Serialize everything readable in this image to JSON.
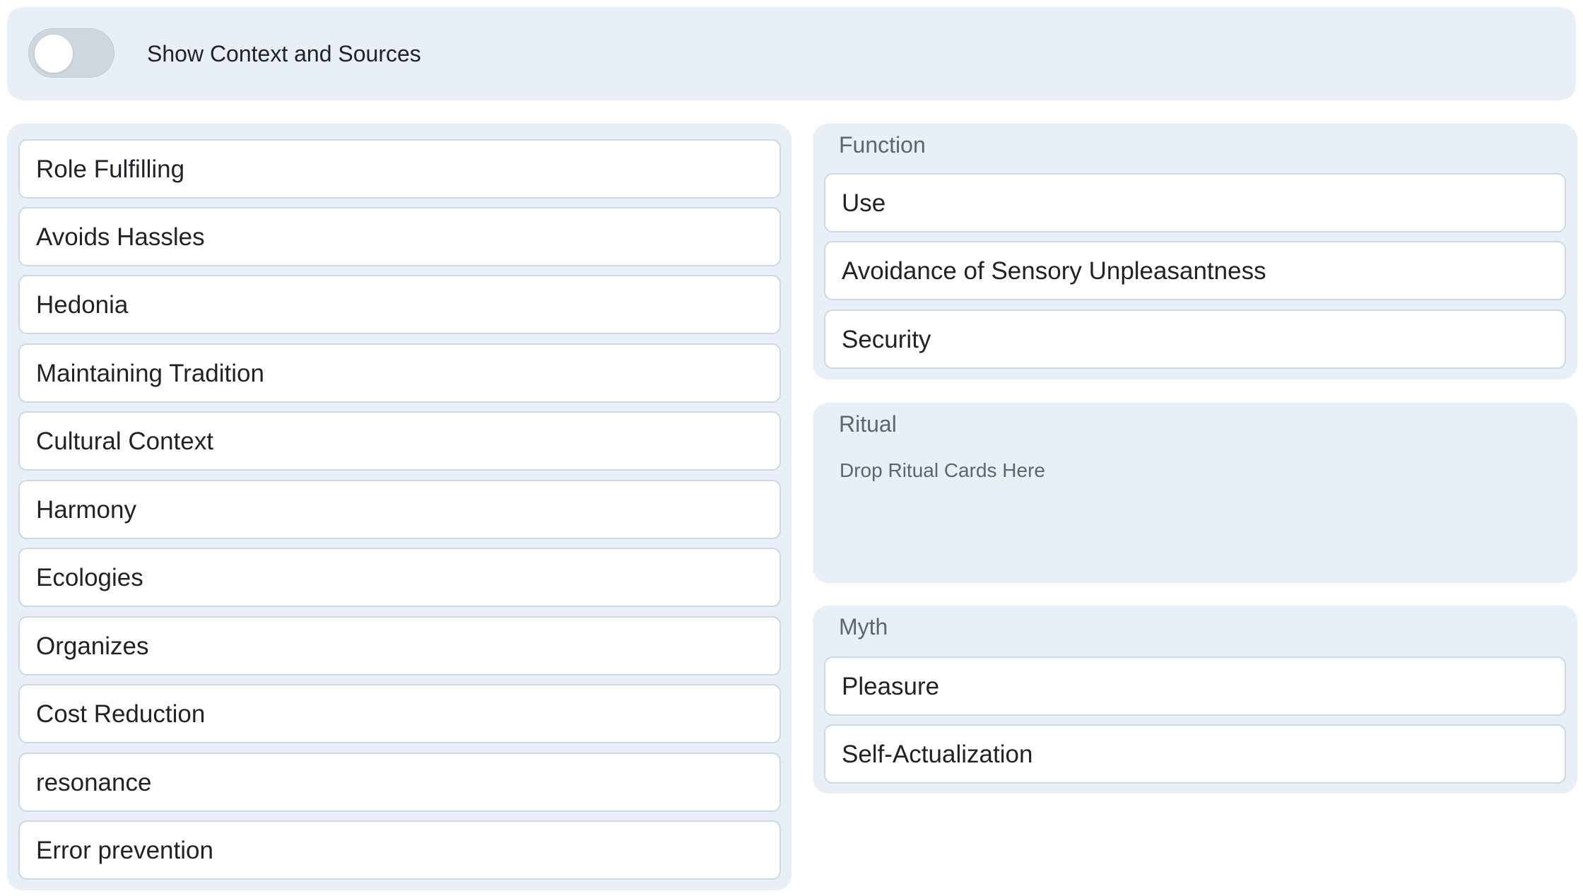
{
  "toggle": {
    "label": "Show Context and Sources",
    "checked": false
  },
  "pool": {
    "cards": [
      {
        "label": "Role Fulfilling"
      },
      {
        "label": "Avoids Hassles"
      },
      {
        "label": "Hedonia"
      },
      {
        "label": "Maintaining Tradition"
      },
      {
        "label": "Cultural Context"
      },
      {
        "label": "Harmony"
      },
      {
        "label": "Ecologies"
      },
      {
        "label": "Organizes"
      },
      {
        "label": "Cost Reduction"
      },
      {
        "label": "resonance"
      },
      {
        "label": "Error prevention"
      }
    ]
  },
  "zones": {
    "function": {
      "title": "Function",
      "cards": [
        {
          "label": "Use"
        },
        {
          "label": "Avoidance of Sensory Unpleasantness"
        },
        {
          "label": "Security"
        }
      ]
    },
    "ritual": {
      "title": "Ritual",
      "placeholder": "Drop Ritual Cards Here",
      "cards": []
    },
    "myth": {
      "title": "Myth",
      "cards": [
        {
          "label": "Pleasure"
        },
        {
          "label": "Self-Actualization"
        }
      ]
    }
  },
  "colors": {
    "panel_bg": "#e8eff6",
    "card_border": "#c9d9e8",
    "muted_text": "#5b6672",
    "switch_off": "#cdd7e0"
  }
}
